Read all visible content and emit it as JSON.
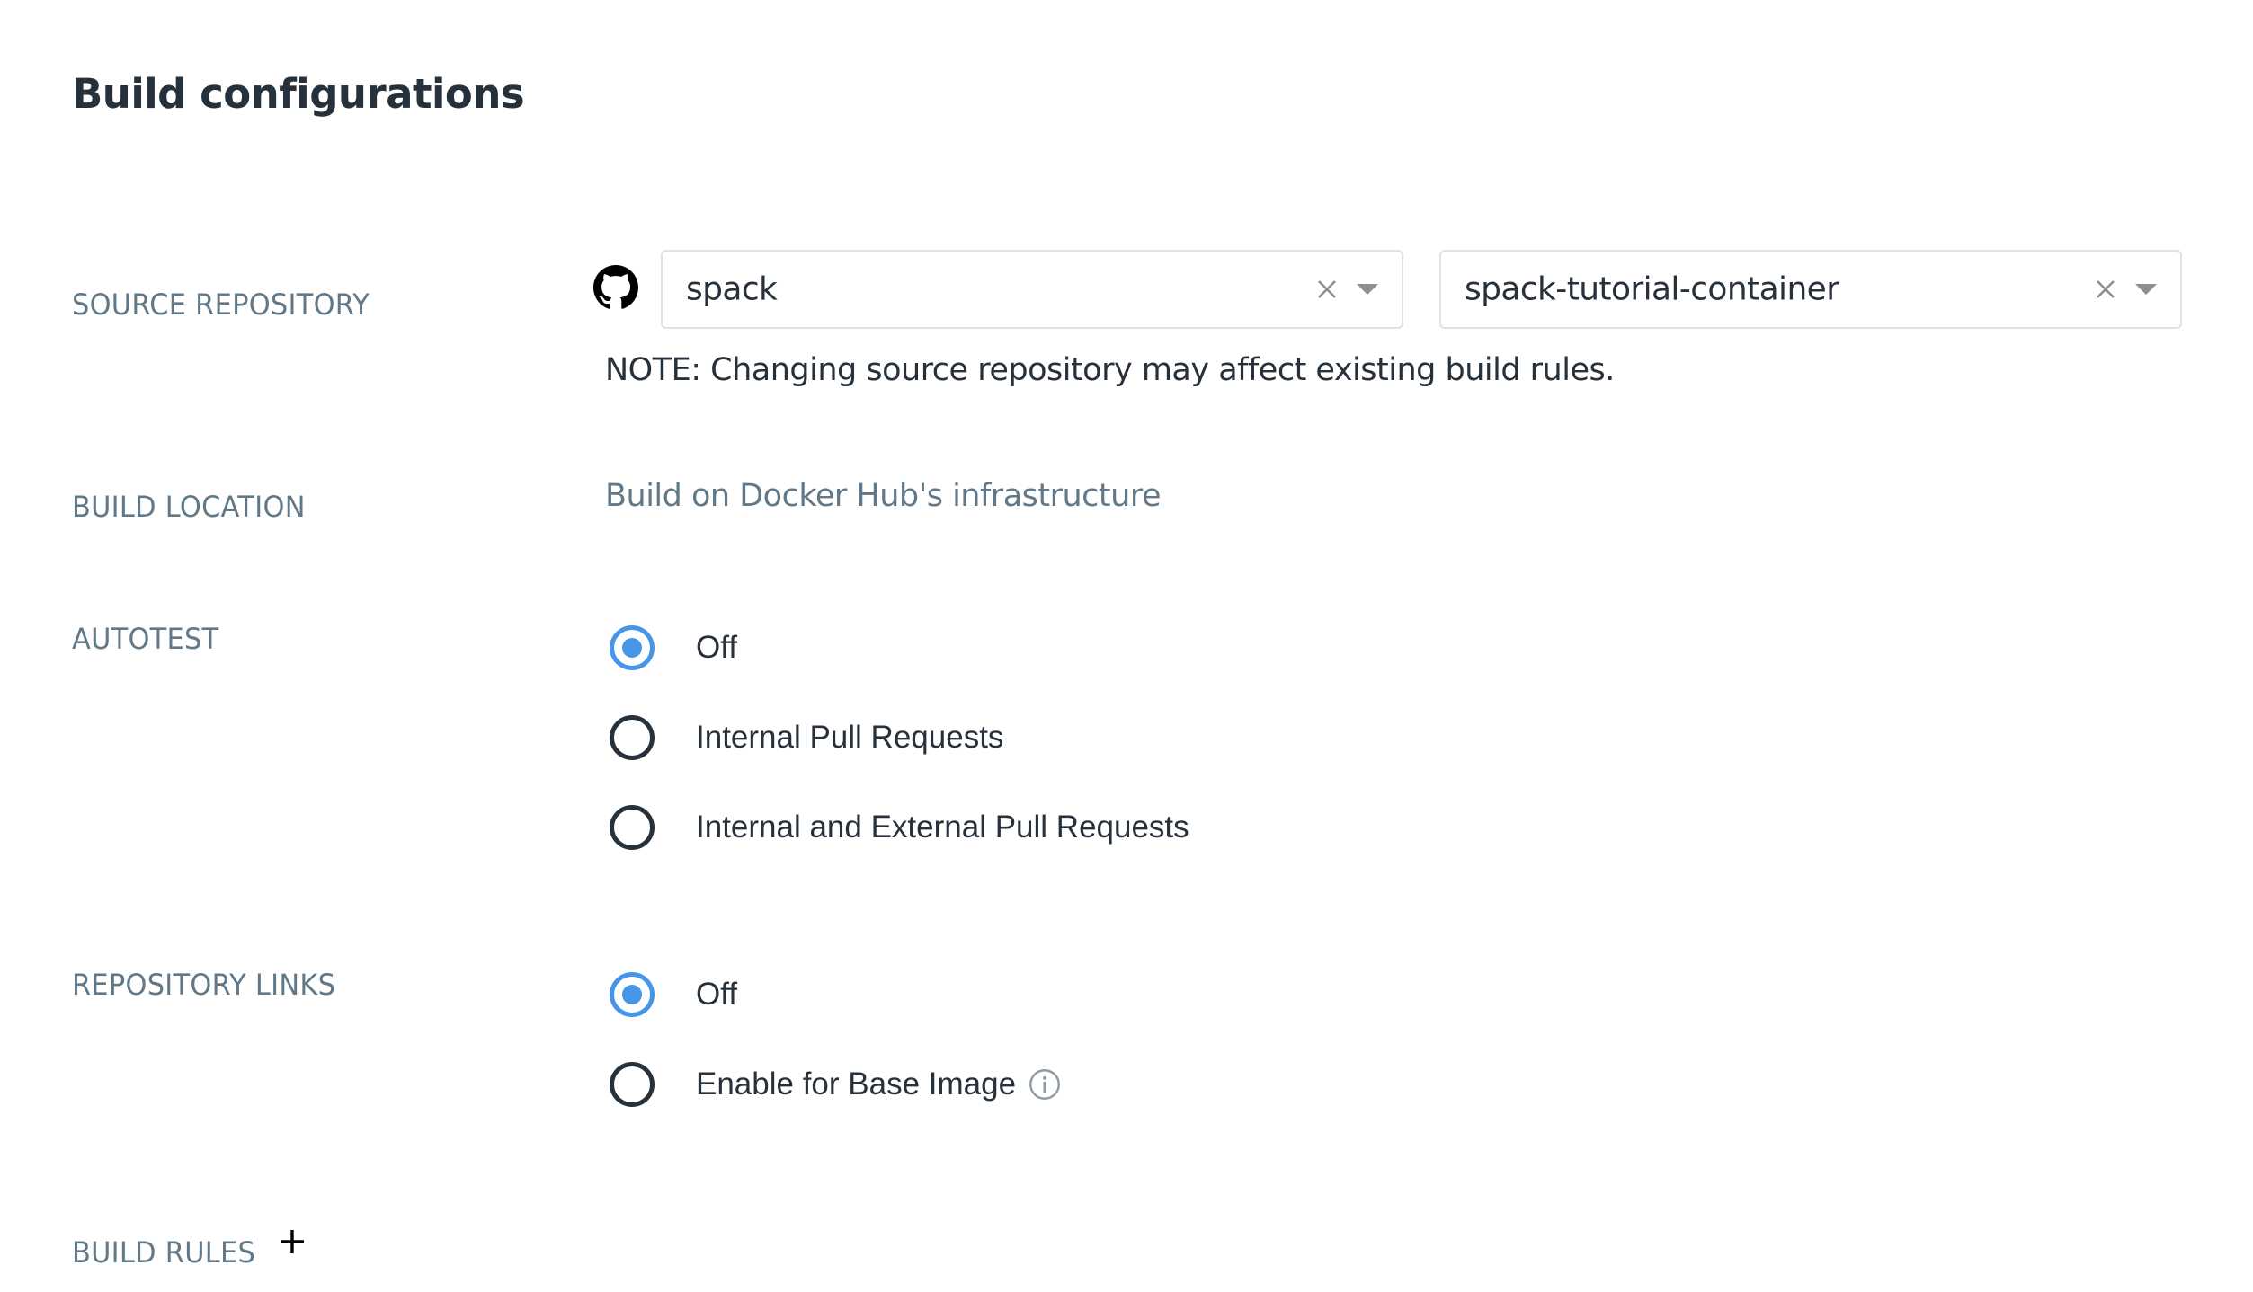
{
  "page": {
    "title": "Build configurations"
  },
  "source_repository": {
    "label": "SOURCE REPOSITORY",
    "provider_icon": "github-icon",
    "organization": {
      "value": "spack",
      "clear_icon": "close-icon",
      "dropdown_icon": "caret-down-icon"
    },
    "repository": {
      "value": "spack-tutorial-container",
      "clear_icon": "close-icon",
      "dropdown_icon": "caret-down-icon"
    },
    "note": "NOTE: Changing source repository may affect existing build rules."
  },
  "build_location": {
    "label": "BUILD LOCATION",
    "value": "Build on Docker Hub's infrastructure"
  },
  "autotest": {
    "label": "AUTOTEST",
    "selected": "Off",
    "options": [
      {
        "label": "Off",
        "checked": true
      },
      {
        "label": "Internal Pull Requests",
        "checked": false
      },
      {
        "label": "Internal and External Pull Requests",
        "checked": false
      }
    ]
  },
  "repository_links": {
    "label": "REPOSITORY LINKS",
    "selected": "Off",
    "options": [
      {
        "label": "Off",
        "checked": true
      },
      {
        "label": "Enable for Base Image",
        "checked": false,
        "icon": "info-icon"
      }
    ]
  },
  "build_rules": {
    "label": "BUILD RULES",
    "add_icon": "plus-icon"
  },
  "colors": {
    "accent": "#4596e8",
    "label": "#617888",
    "text": "#27313b",
    "border": "#dde3e8"
  }
}
